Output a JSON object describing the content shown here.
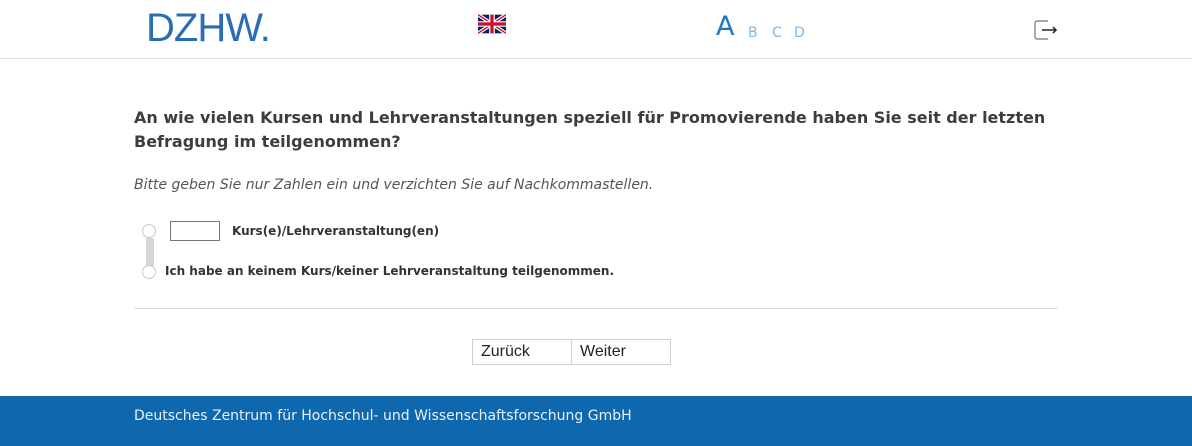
{
  "header": {
    "logo_text": "DZHW.",
    "language_icon": "uk-flag-icon",
    "font_sizes": [
      "A",
      "B",
      "C",
      "D"
    ],
    "logout_icon": "logout-icon"
  },
  "question": {
    "text": "An wie vielen Kursen und Lehrveranstaltungen speziell für Promovierende haben Sie seit der letzten Befragung im teilgenommen?",
    "hint": "Bitte geben Sie nur Zahlen ein und verzichten Sie auf Nachkommastellen."
  },
  "options": {
    "count_input_value": "",
    "count_label": "Kurs(e)/Lehrveranstaltung(en)",
    "none_label": "Ich habe an keinem Kurs/keiner Lehrveranstaltung teilgenommen."
  },
  "nav": {
    "back_label": "Zurück",
    "next_label": "Weiter"
  },
  "footer": {
    "text": "Deutsches Zentrum für Hochschul- und Wissenschaftsforschung GmbH"
  },
  "colors": {
    "brand_blue": "#0f67ae",
    "logo_blue": "#2a6db5",
    "accent_blue": "#1a78c2"
  }
}
